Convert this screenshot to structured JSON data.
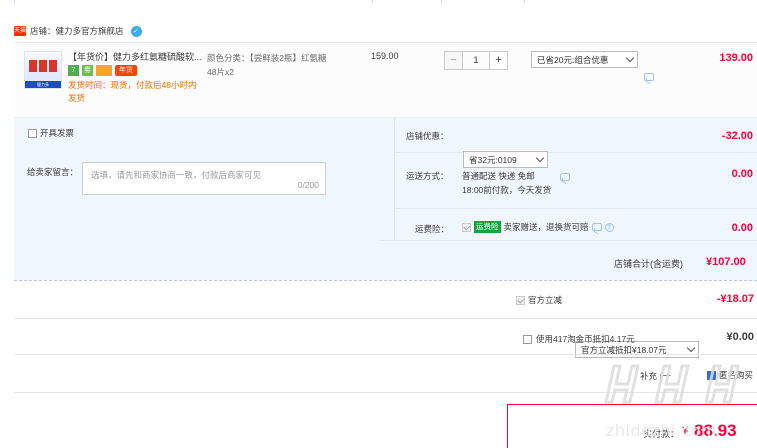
{
  "shop": {
    "label": "店铺：健力多官方旗舰店",
    "icon": "tmall-shop-icon",
    "ww_icon": "wangwang-chat-icon"
  },
  "item": {
    "title": "【年货价】健力多红氨糖硫酸软...",
    "badges": [
      "7",
      "劵",
      "",
      "年货"
    ],
    "delivery": "发货时间：现货，付款后48小时内发货",
    "sku_label": "颜色分类：【尝鲜装2瓶】红氨糖",
    "sku_spec": "48片x2",
    "unit_price": "159.00",
    "quantity": "1",
    "promo_select": "已省20元:组合优惠",
    "amount": "139.00"
  },
  "invoice_label": "开具发票",
  "message": {
    "label": "给卖家留言：",
    "placeholder": "选填，请先和商家协商一致，付款后商家可见",
    "counter": "0/200"
  },
  "shop_discount": {
    "label": "店铺优惠：",
    "select": "省32元:0109",
    "amount": "-32.00"
  },
  "shipping": {
    "label": "运送方式：",
    "line1": "普通配送 快递 免邮",
    "line2": "18:00前付款，今天发货",
    "amount": "0.00"
  },
  "freight_insurance": {
    "label": "运费险：",
    "tag": "运费险",
    "text": "卖家赠送，退换货可赔",
    "amount": "0.00"
  },
  "shop_total": {
    "label": "店铺合计(含运费)",
    "value": "¥107.00"
  },
  "instant_discount": {
    "label": "官方立减",
    "select": "官方立减抵扣¥18.07元",
    "amount": "-¥18.07"
  },
  "coins": {
    "label": "使用417淘金币抵扣4.17元",
    "amount": "¥0.00"
  },
  "misc": {
    "partial_left": "补充 (一",
    "partial_right": "匿名购买"
  },
  "pay": {
    "label": "实付款：",
    "currency": "¥",
    "value": "88.93"
  },
  "watermark": {
    "text": "zhidezhi.com"
  },
  "colors": {
    "accent": "#ff0036",
    "orange": "#ff6a00",
    "band": "#f0f6fe",
    "green": "#18a33a"
  }
}
